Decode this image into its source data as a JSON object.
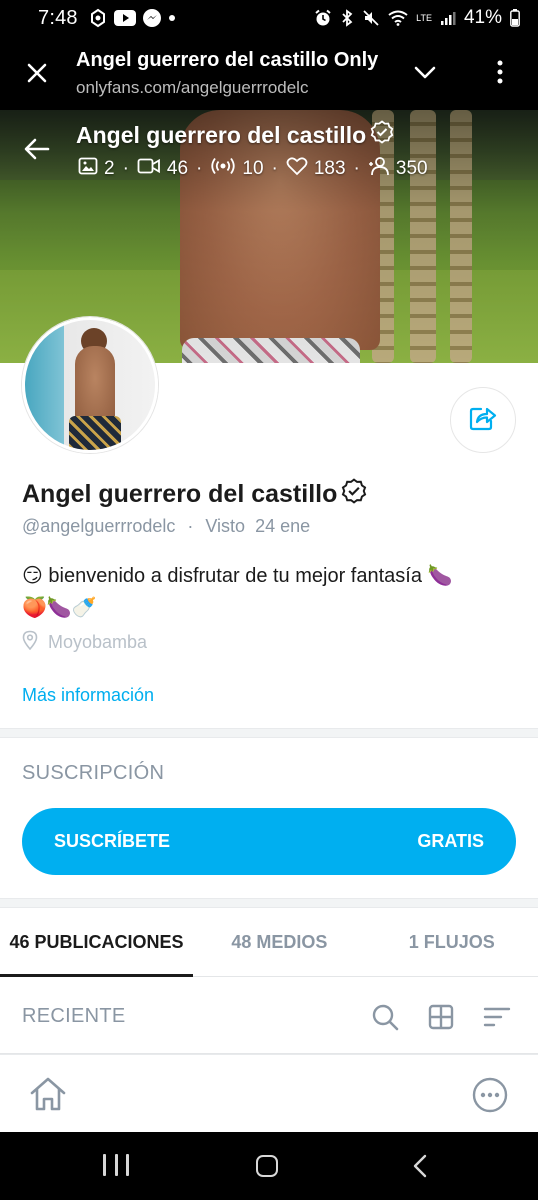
{
  "status_bar": {
    "time": "7:48",
    "battery_text": "41%",
    "lte_label": "LTE"
  },
  "browser": {
    "title": "Angel guerrero del castillo Only",
    "url": "onlyfans.com/angelguerrrodelc"
  },
  "cover": {
    "name": "Angel guerrero del castillo",
    "stats": {
      "photos": "2",
      "videos": "46",
      "streams": "10",
      "likes": "183",
      "fans": "350"
    },
    "stat_separator": "·"
  },
  "profile": {
    "name": "Angel guerrero del castillo",
    "handle": "@angelguerrrodelc",
    "separator": "·",
    "last_seen": "Visto  24 ene",
    "bio_line1": "😏 bienvenido a disfrutar de tu mejor fantasía 🍆",
    "bio_line2": "🍑🍆🍼",
    "location": "Moyobamba",
    "more_info": "Más información"
  },
  "subscription": {
    "title": "SUSCRIPCIÓN",
    "button_label": "SUSCRÍBETE",
    "button_price": "GRATIS"
  },
  "tabs": [
    {
      "label": "46 PUBLICACIONES",
      "active": true
    },
    {
      "label": "48 MEDIOS",
      "active": false
    },
    {
      "label": "1 FLUJOS",
      "active": false
    }
  ],
  "recent": {
    "label": "RECIENTE"
  },
  "colors": {
    "accent": "#00aff0",
    "link": "#00aeef",
    "muted": "#8a96a3",
    "text": "#1b1b1b"
  },
  "icons": {
    "close": "close-icon",
    "chevron": "chevron-down-icon",
    "menu": "more-vert-icon",
    "back": "arrow-back-icon",
    "verified": "verified-badge-icon",
    "share": "share-icon",
    "location": "location-pin-icon",
    "search": "search-icon",
    "grid": "grid-icon",
    "sort": "sort-icon",
    "home": "home-icon",
    "more": "more-horiz-icon"
  }
}
